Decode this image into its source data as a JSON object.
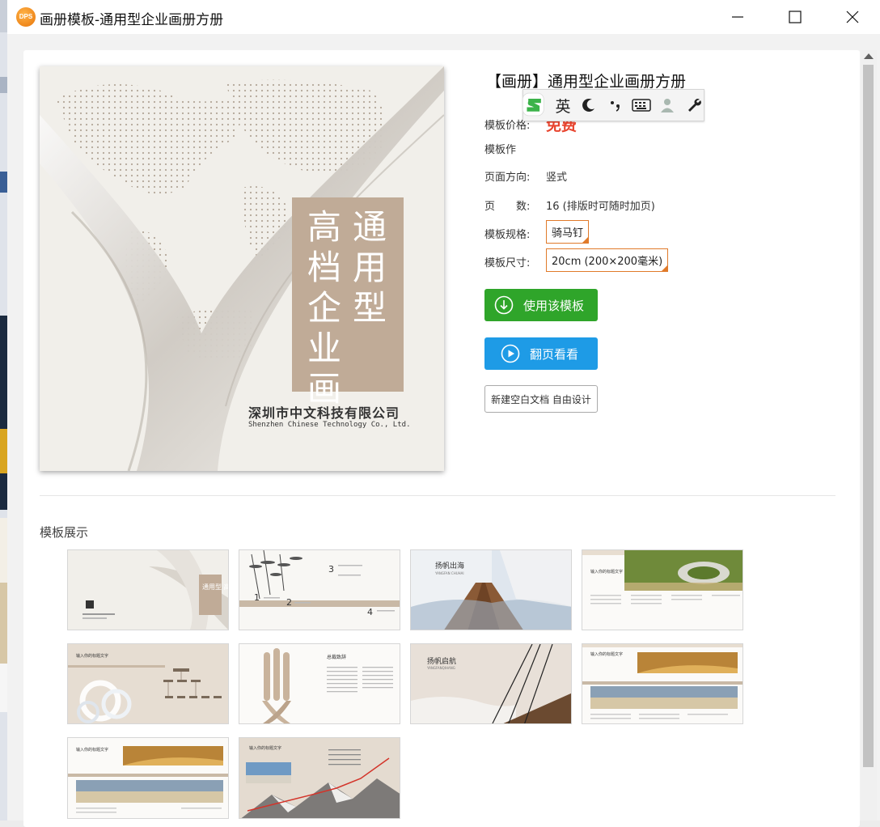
{
  "window": {
    "title": "画册模板-通用型企业画册方册",
    "app_icon_label": "DPS"
  },
  "template": {
    "title": "【画册】通用型企业画册方册",
    "price_label": "模板价格:",
    "price_value": "免费",
    "author_label": "模板作",
    "orientation_label": "页面方向:",
    "orientation_value": "竖式",
    "pages_label": "页　　数:",
    "pages_value": "16 (排版时可随时加页)",
    "binding_label": "模板规格:",
    "binding_value": "骑马钉",
    "size_label": "模板尺寸:",
    "size_value": "20cm (200×200毫米)"
  },
  "cover": {
    "title_col1": "通用型",
    "title_col2": "高档企业画",
    "company_cn": "深圳市中文科技有限公司",
    "company_en": "Shenzhen Chinese Technology Co., Ltd."
  },
  "buttons": {
    "use_template": "使用该模板",
    "flip_preview": "翻页看看",
    "new_blank": "新建空白文档 自由设计"
  },
  "ime": {
    "mode_label": "英"
  },
  "showcase": {
    "title": "模板展示",
    "thumbs": [
      {
        "heading": "",
        "caption": "通用型 高档企业画"
      },
      {
        "heading": "",
        "caption": ""
      },
      {
        "heading": "扬帆出海",
        "caption": "YANGFAN CHUHAI"
      },
      {
        "heading": "输入你的标题文字",
        "caption": ""
      },
      {
        "heading": "输入你的标题文字",
        "caption": ""
      },
      {
        "heading": "总裁致辞",
        "caption": ""
      },
      {
        "heading": "扬帆启航",
        "caption": "YANGFANQIHANG"
      },
      {
        "heading": "输入你的标题文字",
        "caption": ""
      },
      {
        "heading": "输入你的标题文字",
        "caption": ""
      },
      {
        "heading": "输入你的标题文字",
        "caption": ""
      }
    ]
  },
  "colors": {
    "price": "#e8442e",
    "use_button": "#2fa52a",
    "flip_button": "#1e9be6",
    "spec_border": "#e07a2a",
    "cover_box": "#c0ab97"
  }
}
